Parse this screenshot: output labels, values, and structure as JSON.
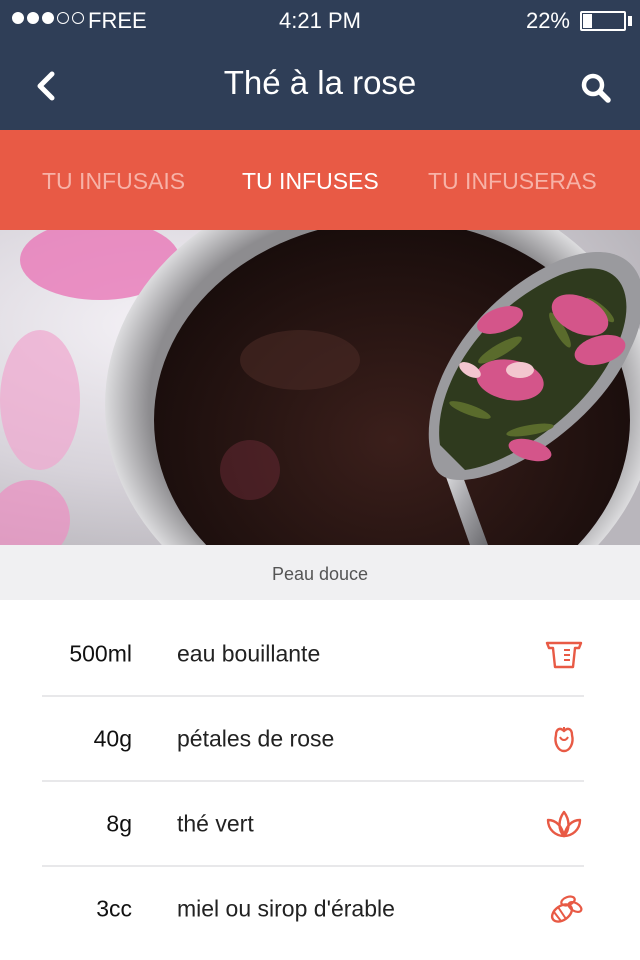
{
  "status": {
    "carrier": "FREE",
    "time": "4:21  PM",
    "battery": "22%",
    "battery_level": 0.22,
    "signal_bars": 3,
    "signal_total": 5
  },
  "nav": {
    "title": "Thé à la rose",
    "back_icon": "chevron-left-icon",
    "search_icon": "search-icon"
  },
  "tabs": [
    {
      "label": "TU INFUSAIS",
      "active": false
    },
    {
      "label": "TU INFUSES",
      "active": true
    },
    {
      "label": "TU INFUSERAS",
      "active": false
    }
  ],
  "hero": {
    "caption": "Peau douce"
  },
  "ingredients": [
    {
      "qty": "500ml",
      "name": "eau bouillante",
      "icon": "measuring-cup-icon"
    },
    {
      "qty": "40g",
      "name": "pétales de rose",
      "icon": "rose-icon"
    },
    {
      "qty": "8g",
      "name": "thé vert",
      "icon": "leaves-icon"
    },
    {
      "qty": "3cc",
      "name": "miel ou sirop d'érable",
      "icon": "bee-icon"
    }
  ],
  "colors": {
    "nav_bg": "#2f3e57",
    "tab_bg": "#e85a45",
    "accent_icon": "#e85a45"
  }
}
